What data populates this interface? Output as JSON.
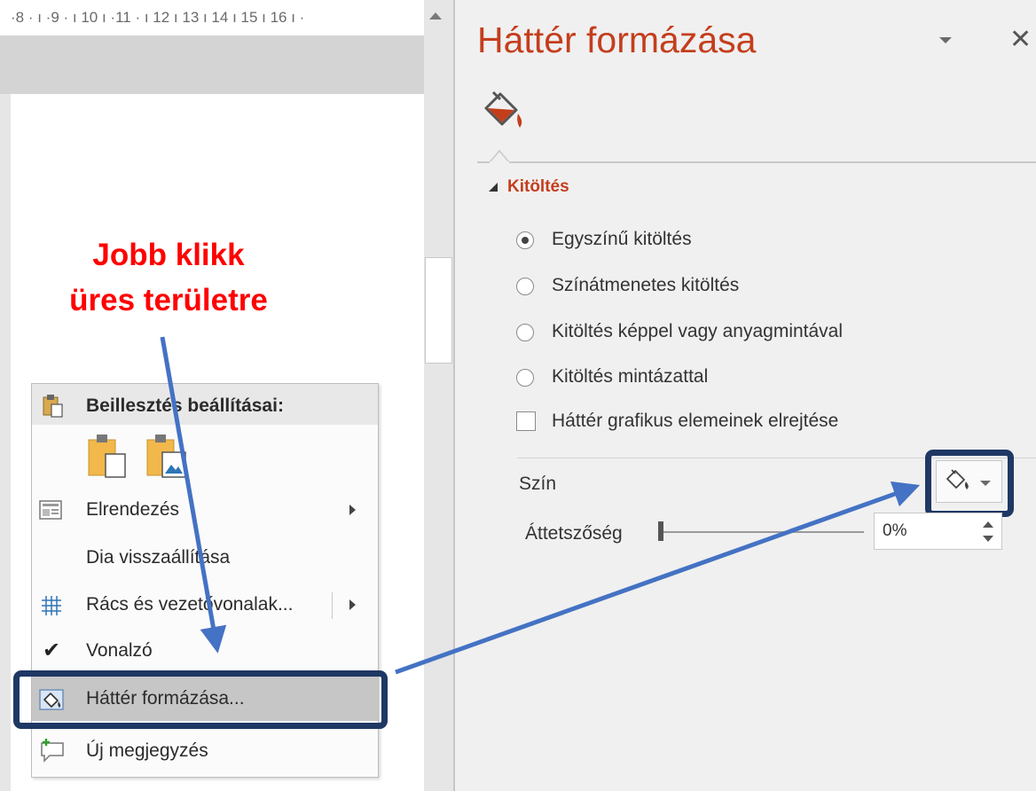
{
  "ruler": {
    "text": "·8 · ı ·9 · ı 10 ı ·11 · ı 12 ı 13 ı 14 ı 15 ı 16 ı ·"
  },
  "annotation": {
    "line1": "Jobb klikk",
    "line2": "üres területre"
  },
  "pane": {
    "title": "Háttér formázása",
    "tab_icon": "paint-bucket-icon",
    "section_title": "Kitöltés",
    "options": [
      {
        "label": "Egyszínű kitöltés",
        "selected": true
      },
      {
        "label": "Színátmenetes kitöltés",
        "selected": false
      },
      {
        "label": "Kitöltés képpel vagy anyagmintával",
        "selected": false
      },
      {
        "label": "Kitöltés mintázattal",
        "selected": false
      }
    ],
    "checkbox_label": "Háttér grafikus elemeinek elrejtése",
    "checkbox_checked": false,
    "color_label": "Szín",
    "transparency_label": "Áttetszőség",
    "transparency_value": "0%",
    "transparency_level_percent": 0
  },
  "menu": {
    "header": "Beillesztés beállításai:",
    "items": [
      {
        "label": "Elrendezés",
        "icon": "layout-icon",
        "submenu": true
      },
      {
        "label": "Dia visszaállítása",
        "icon": "",
        "submenu": false
      },
      {
        "label": "Rács és vezetővonalak...",
        "icon": "grid-icon",
        "submenu": true
      },
      {
        "label": "Vonalzó",
        "icon": "checkmark-icon",
        "submenu": false,
        "checked": true
      },
      {
        "label": "Háttér formázása...",
        "icon": "format-background-icon",
        "submenu": false,
        "highlighted": true
      },
      {
        "label": "Új megjegyzés",
        "icon": "new-comment-icon",
        "submenu": false
      }
    ]
  },
  "colors": {
    "pane_title": "#c43e1c",
    "annotation": "#ff0000",
    "arrow": "#4472c4",
    "highlight_border": "#1f3864"
  }
}
